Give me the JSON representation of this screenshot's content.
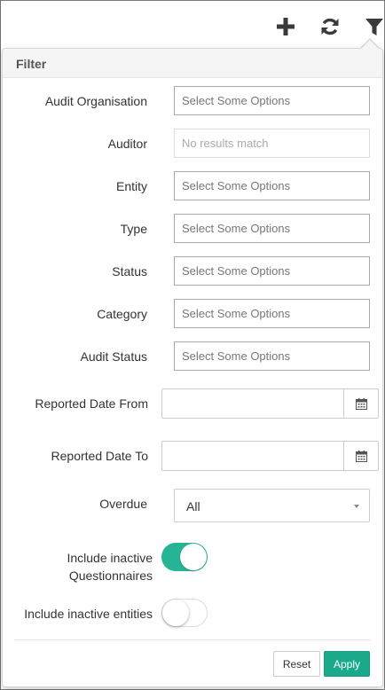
{
  "toolbar": {
    "icons": [
      "plus-icon",
      "refresh-icon",
      "filter-icon"
    ]
  },
  "panel": {
    "title": "Filter"
  },
  "fields": {
    "audit_organisation": {
      "label": "Audit Organisation",
      "placeholder": "Select Some Options"
    },
    "auditor": {
      "label": "Auditor",
      "placeholder": "No results match"
    },
    "entity": {
      "label": "Entity",
      "placeholder": "Select Some Options"
    },
    "type": {
      "label": "Type",
      "placeholder": "Select Some Options"
    },
    "status": {
      "label": "Status",
      "placeholder": "Select Some Options"
    },
    "category": {
      "label": "Category",
      "placeholder": "Select Some Options"
    },
    "audit_status": {
      "label": "Audit Status",
      "placeholder": "Select Some Options"
    },
    "reported_date_from": {
      "label": "Reported Date From",
      "value": ""
    },
    "reported_date_to": {
      "label": "Reported Date To",
      "value": ""
    },
    "overdue": {
      "label": "Overdue",
      "value": "All"
    },
    "include_inactive_questionnaires": {
      "label_line1": "Include inactive",
      "label_line2": "Questionnaires",
      "checked": true
    },
    "include_inactive_entities": {
      "label": "Include inactive entities",
      "checked": false
    }
  },
  "buttons": {
    "reset": "Reset",
    "apply": "Apply"
  },
  "colors": {
    "accent": "#26b494",
    "apply": "#1aaa8b"
  }
}
